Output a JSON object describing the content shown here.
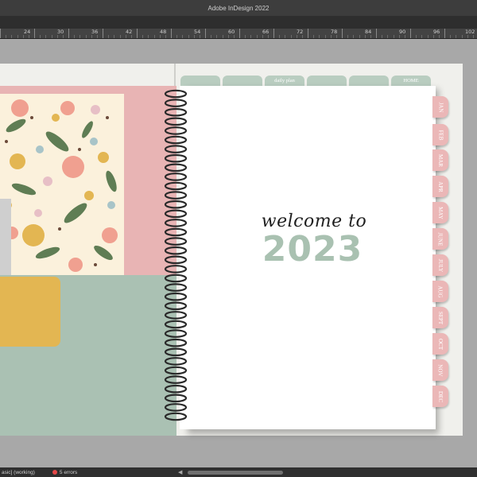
{
  "app": {
    "title": "Adobe InDesign 2022"
  },
  "ruler": {
    "labels": [
      "24",
      "30",
      "36",
      "42",
      "48",
      "54",
      "60",
      "66",
      "72",
      "78",
      "84",
      "90",
      "96",
      "102"
    ]
  },
  "planner": {
    "top_tabs": [
      "",
      "",
      "daily plan",
      "",
      "",
      "HOME"
    ],
    "side_tabs": [
      "JAN",
      "FEB",
      "MAR",
      "APR",
      "MAY",
      "JUNE",
      "JULY",
      "AUG",
      "SEPT",
      "OCT",
      "NOV",
      "DEC"
    ],
    "welcome_text": "welcome to",
    "year": "2023"
  },
  "statusbar": {
    "doc_label": "asic] (working)",
    "errors_label": "5 errors"
  },
  "colors": {
    "sage": "#a9c1b1",
    "pink_tab": "#ebb7b7",
    "pink_block": "#e8b4b4",
    "yellow": "#e3b652",
    "cream": "#fbf1dc"
  }
}
